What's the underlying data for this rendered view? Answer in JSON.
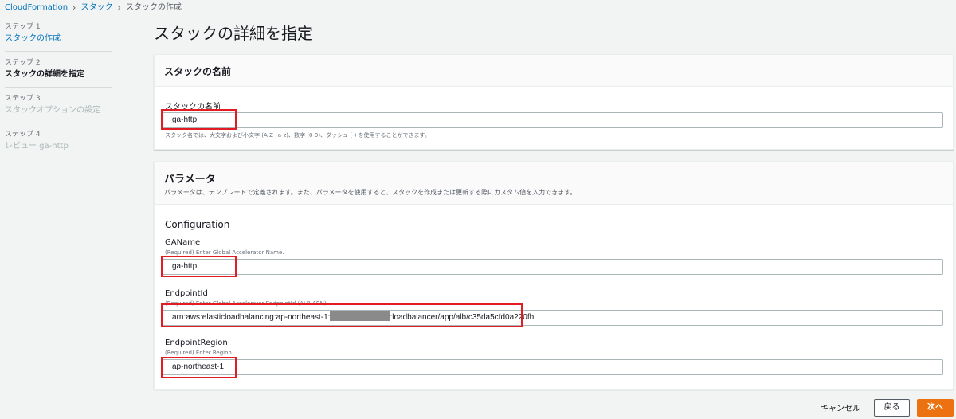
{
  "breadcrumb": {
    "items": [
      "CloudFormation",
      "スタック",
      "スタックの作成"
    ]
  },
  "steps": [
    {
      "num": "ステップ 1",
      "title": "スタックの作成"
    },
    {
      "num": "ステップ 2",
      "title": "スタックの詳細を指定"
    },
    {
      "num": "ステップ 3",
      "title": "スタックオプションの設定"
    },
    {
      "num": "ステップ 4",
      "title": "レビュー ga-http"
    }
  ],
  "page": {
    "title": "スタックの詳細を指定"
  },
  "stack_name_panel": {
    "title": "スタックの名前",
    "label": "スタックの名前",
    "value": "ga-http",
    "hint": "スタック名では、大文字および小文字 (A-Z~a-z)、数字 (0-9)、ダッシュ (-) を使用することができます。"
  },
  "params_panel": {
    "title": "パラメータ",
    "description": "パラメータは、テンプレートで定義されます。また、パラメータを使用すると、スタックを作成または更新する際にカスタム値を入力できます。",
    "config_heading": "Configuration",
    "fields": [
      {
        "label": "GAName",
        "hint": "(Required) Enter Global Accelerator Name.",
        "value": "ga-http"
      },
      {
        "label": "EndpointId",
        "hint": "(Required) Enter Global Accelerator EndpointId (ALB ARN).",
        "value_prefix": "arn:aws:elasticloadbalancing:ap-northeast-1:",
        "value_suffix": ":loadbalancer/app/alb/c35da5cfd0a220fb"
      },
      {
        "label": "EndpointRegion",
        "hint": "(Required) Enter Region.",
        "value": "ap-northeast-1"
      }
    ]
  },
  "actions": {
    "cancel": "キャンセル",
    "back": "戻る",
    "next": "次へ"
  },
  "colors": {
    "accent": "#0073bb",
    "primary_button": "#ec7211",
    "highlight": "#e31b23"
  }
}
